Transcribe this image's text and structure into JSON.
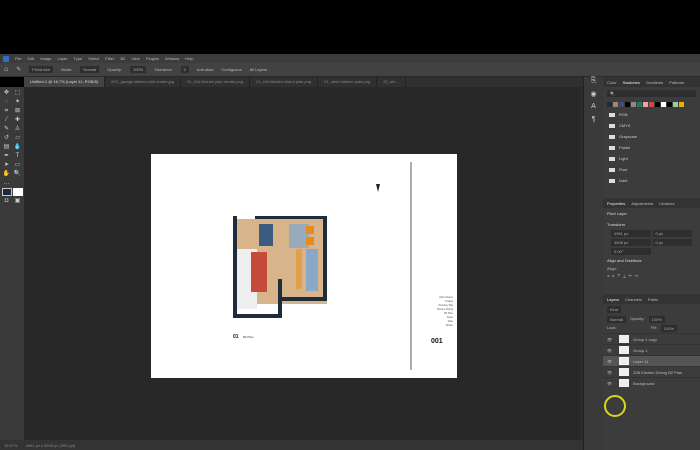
{
  "menu": [
    "File",
    "Edit",
    "Image",
    "Layer",
    "Type",
    "Select",
    "Filter",
    "3D",
    "View",
    "Plugins",
    "Window",
    "Help"
  ],
  "options": {
    "tool_preset": "Fixed size",
    "mode_label": "Mode:",
    "mode": "Normal",
    "opacity_label": "Opacity:",
    "opacity": "100%",
    "tolerance_label": "Tolerance:",
    "tolerance": "0",
    "anti_alias": "Anti-alias",
    "contiguous": "Contiguous",
    "all_layers": "All Layers"
  },
  "tabs": [
    "Untitled-1 @ 16.7% (Layer 11, RGB/8)",
    "20C_garage kitchen sink render.jpg",
    "21_b2d kitchen plan render.png",
    "21_b2d kitchen island plan.png",
    "21_other kitchen plan.png",
    "22_ele..."
  ],
  "status": {
    "zoom": "16.67%",
    "size": "4961 px x 3508 px (300 ppi)"
  },
  "swatches": {
    "tabs": [
      "Color",
      "Swatches",
      "Gradients",
      "Patterns"
    ],
    "active": 1,
    "colors": [
      "#1e2a36",
      "#a08670",
      "#3a4f70",
      "#000000",
      "#888888",
      "#1a7a5a",
      "#f2a0a0",
      "#e04040",
      "#000000",
      "#ffffff",
      "#000000",
      "#9ccc9c",
      "#f0b000"
    ],
    "folders": [
      "RGB",
      "CMYK",
      "Grayscale",
      "Pastel",
      "Light",
      "Pure",
      "Dark"
    ]
  },
  "properties": {
    "tabs": [
      "Properties",
      "Adjustments",
      "Libraries"
    ],
    "kind": "Pixel Layer",
    "transform": "Transform",
    "w": "4961 px",
    "h": "3508 px",
    "x": "0 px",
    "y": "0 px",
    "angle": "0.00°",
    "align": "Align and Distribute",
    "align_sub": "Align:"
  },
  "layers": {
    "tabs": [
      "Layers",
      "Channels",
      "Paths"
    ],
    "kind": "Kind",
    "blend": "Normal",
    "opacity_label": "Opacity:",
    "opacity": "100%",
    "lock_label": "Lock:",
    "fill_label": "Fill:",
    "fill": "100%",
    "items": [
      {
        "name": "Group 1 copy",
        "selected": false
      },
      {
        "name": "Group 1",
        "selected": false
      },
      {
        "name": "Layer 11",
        "selected": true
      },
      {
        "name": "20B Kitchen Dining B2 Plan",
        "selected": false
      },
      {
        "name": "Background",
        "selected": false
      }
    ]
  },
  "drawing": {
    "label_num": "01",
    "label_title": "B2 Plan",
    "sheet": "001",
    "title_block": [
      "Client Name",
      "Project",
      "Drawing Title",
      "Kitchen Dining",
      "B2 Plan",
      "Scale",
      "Date",
      "Drawn"
    ]
  }
}
